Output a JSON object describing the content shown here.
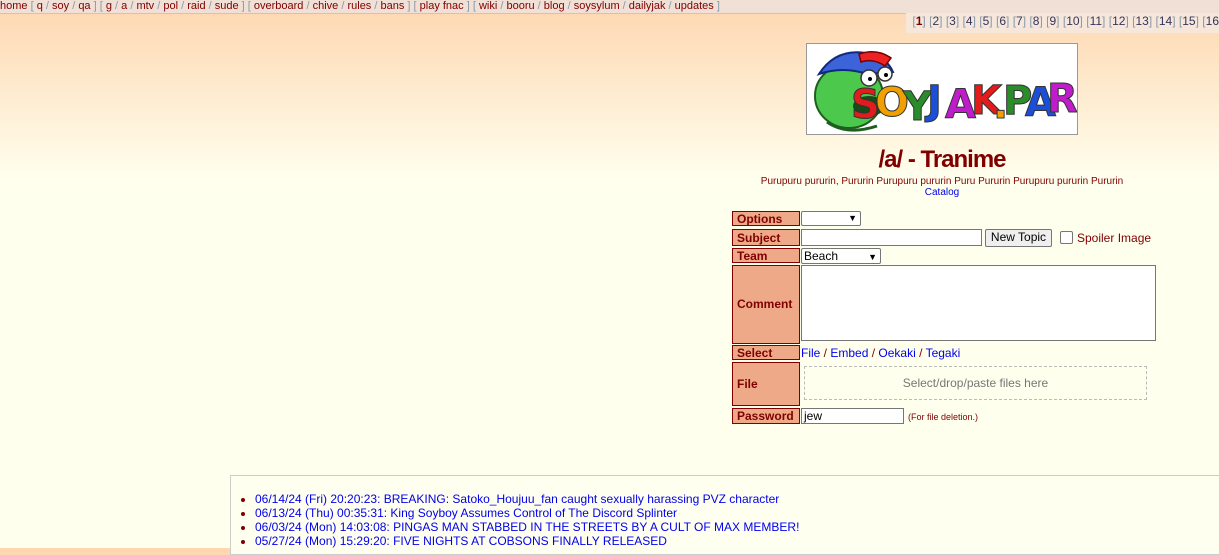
{
  "boardlist": [
    {
      "links": [
        "home"
      ],
      "open": false
    },
    {
      "links": [
        "q",
        "soy",
        "qa"
      ]
    },
    {
      "links": [
        "g",
        "a",
        "mtv",
        "pol",
        "raid",
        "sude"
      ]
    },
    {
      "links": [
        "overboard",
        "chive",
        "rules",
        "bans"
      ]
    },
    {
      "links": [
        "play fnac"
      ]
    },
    {
      "links": [
        "wiki",
        "booru",
        "blog",
        "soysylum",
        "dailyjak",
        "updates"
      ]
    }
  ],
  "pages": {
    "current": "1",
    "others": [
      "2",
      "3",
      "4",
      "5",
      "6",
      "7",
      "8",
      "9",
      "10",
      "11",
      "12",
      "13",
      "14",
      "15",
      "16"
    ]
  },
  "banner": {
    "text": "SOYJAK.PARTY",
    "letter_colors": [
      "#e21c1c",
      "#f0a000",
      "#2a8c2a",
      "#1c4fd8",
      "#c01ccc",
      "#e21c1c",
      "#f0a000",
      "#2a8c2a",
      "#1c4fd8",
      "#c01ccc",
      "#e21c1c",
      "#f0a000"
    ]
  },
  "board": {
    "title": "/a/ - Tranime",
    "subtitle": "Purupuru pururin, Pururin Purupuru pururin Puru Pururin Purupuru pururin Pururin",
    "catalog_link": "Catalog"
  },
  "form": {
    "options_label": "Options",
    "options_value": "",
    "subject_label": "Subject",
    "subject_value": "",
    "new_topic_button": "New Topic",
    "spoiler_label": "Spoiler Image",
    "team_label": "Team",
    "team_value": "Beach",
    "comment_label": "Comment",
    "comment_value": "",
    "select_label": "Select",
    "select_links": [
      "File",
      "Embed",
      "Oekaki",
      "Tegaki"
    ],
    "file_label": "File",
    "dropzone_text": "Select/drop/paste files here",
    "password_label": "Password",
    "password_value": "jew",
    "password_note": "(For file deletion.)"
  },
  "news": [
    "06/14/24 (Fri) 20:20:23: BREAKING: Satoko_Houjuu_fan caught sexually harassing PVZ character",
    "06/13/24 (Thu) 00:35:31: King Soyboy Assumes Control of The Discord Splinter",
    "06/03/24 (Mon) 14:03:08: PINGAS MAN STABBED IN THE STREETS BY A CULT OF MAX MEMBER!",
    "05/27/24 (Mon) 15:29:20: FIVE NIGHTS AT COBSONS FINALLY RELEASED"
  ]
}
